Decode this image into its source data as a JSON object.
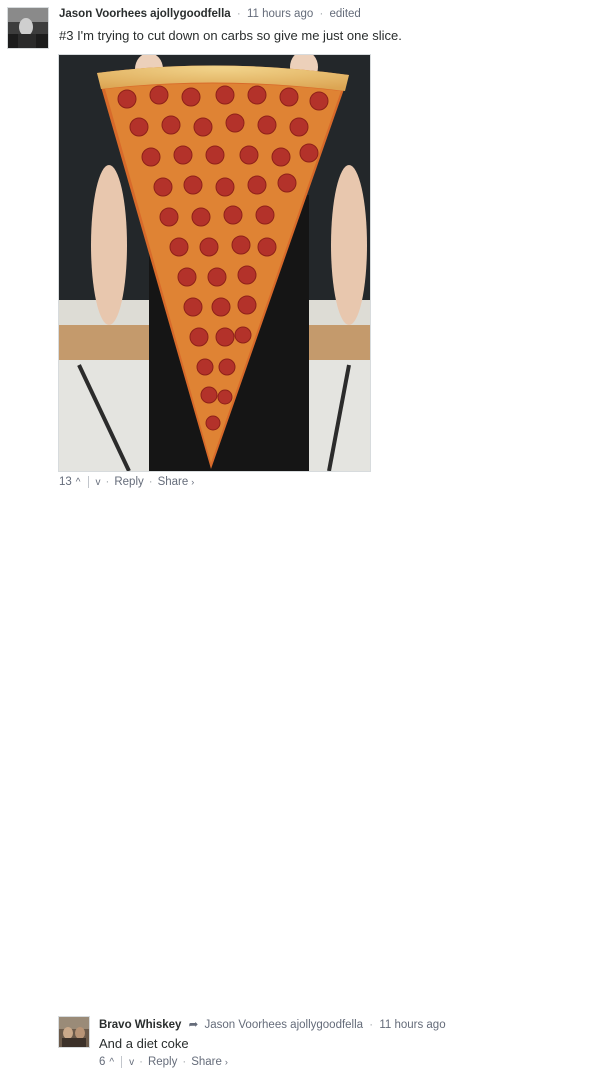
{
  "comments": [
    {
      "author": "Jason Voorhees ajollygoodfella",
      "time": "11 hours ago",
      "edited": "edited",
      "text": "#3 I'm trying to cut down on carbs so give me just one slice.",
      "upvotes": "13",
      "reply_label": "Reply",
      "share_label": "Share"
    },
    {
      "author": "Bravo Whiskey",
      "reply_to": "Jason Voorhees ajollygoodfella",
      "time": "11 hours ago",
      "text": "And a diet coke",
      "upvotes": "6",
      "reply_label": "Reply",
      "share_label": "Share"
    }
  ],
  "icons": {
    "upvote": "chevron-up-icon",
    "downvote": "chevron-down-icon",
    "reply_to": "reply-arrow-icon",
    "share": "chevron-right-icon"
  },
  "colors": {
    "meta_text": "#656c7a",
    "body_text": "#2a2e2e",
    "border": "#d7dbdd"
  }
}
